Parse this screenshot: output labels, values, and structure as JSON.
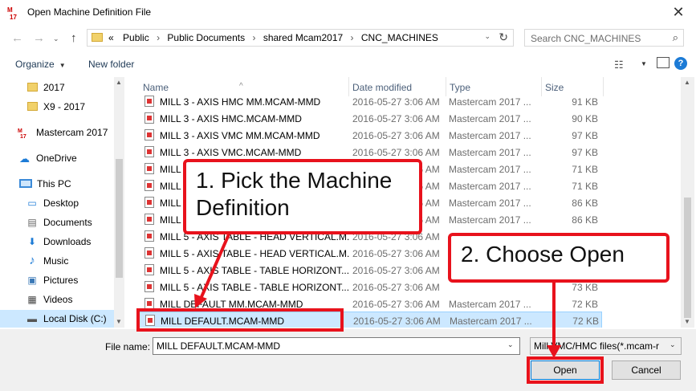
{
  "window": {
    "title": "Open Machine Definition File",
    "close": "✕",
    "logo": "mastercam-logo"
  },
  "nav": {
    "back": "←",
    "forward": "→",
    "up": "↑",
    "refresh": "↻",
    "dropdown": "⌄"
  },
  "address": {
    "overflow": "«",
    "crumbs": [
      "Public",
      "Public Documents",
      "shared Mcam2017",
      "CNC_MACHINES"
    ],
    "sep": "›"
  },
  "search": {
    "placeholder": "Search CNC_MACHINES",
    "icon": "⌕"
  },
  "toolbar": {
    "organize": "Organize",
    "new_folder": "New folder",
    "caret": "▼",
    "view_icon": "☷",
    "help": "?"
  },
  "sidebar": {
    "items": [
      {
        "label": "2017",
        "icon": "folder"
      },
      {
        "label": "X9 - 2017",
        "icon": "folder"
      },
      {
        "label": "Mastercam 2017",
        "icon": "mastercam"
      },
      {
        "label": "OneDrive",
        "icon": "cloud",
        "glyph": "☁"
      },
      {
        "label": "This PC",
        "icon": "pc"
      },
      {
        "label": "Desktop",
        "icon": "desktop",
        "glyph": "▭"
      },
      {
        "label": "Documents",
        "icon": "documents",
        "glyph": "▤"
      },
      {
        "label": "Downloads",
        "icon": "downloads",
        "glyph": "⬇"
      },
      {
        "label": "Music",
        "icon": "music",
        "glyph": "♪"
      },
      {
        "label": "Pictures",
        "icon": "pictures",
        "glyph": "▣"
      },
      {
        "label": "Videos",
        "icon": "videos",
        "glyph": "▦"
      },
      {
        "label": "Local Disk (C:)",
        "icon": "disk",
        "glyph": "▬"
      }
    ]
  },
  "columns": {
    "name": "Name",
    "date": "Date modified",
    "type": "Type",
    "size": "Size",
    "sort_caret": "^"
  },
  "files": [
    {
      "name": "MILL 3 - AXIS HMC MM.MCAM-MMD",
      "date": "2016-05-27 3:06 AM",
      "type": "Mastercam 2017 ...",
      "size": "91 KB"
    },
    {
      "name": "MILL 3 - AXIS HMC.MCAM-MMD",
      "date": "2016-05-27 3:06 AM",
      "type": "Mastercam 2017 ...",
      "size": "90 KB"
    },
    {
      "name": "MILL 3 - AXIS VMC MM.MCAM-MMD",
      "date": "2016-05-27 3:06 AM",
      "type": "Mastercam 2017 ...",
      "size": "97 KB"
    },
    {
      "name": "MILL 3 - AXIS VMC.MCAM-MMD",
      "date": "2016-05-27 3:06 AM",
      "type": "Mastercam 2017 ...",
      "size": "97 KB"
    },
    {
      "name": "MILL 4",
      "date": "2016-05-27 3:06 AM",
      "type": "Mastercam 2017 ...",
      "size": "71 KB"
    },
    {
      "name": "MILL 4",
      "date": "2016-05-27 3:06 AM",
      "type": "Mastercam 2017 ...",
      "size": "71 KB"
    },
    {
      "name": "MILL 5",
      "date": "2016-05-27 3:06 AM",
      "type": "Mastercam 2017 ...",
      "size": "86 KB"
    },
    {
      "name": "MILL 5",
      "date": "2016-05-27 3:06 AM",
      "type": "Mastercam 2017 ...",
      "size": "86 KB"
    },
    {
      "name": "MILL 5 - AXIS TABLE - HEAD VERTICAL.M...",
      "date": "2016-05-27 3:06 AM",
      "type": "",
      "size": ""
    },
    {
      "name": "MILL 5 - AXIS TABLE - HEAD VERTICAL.M...",
      "date": "2016-05-27 3:06 AM",
      "type": "",
      "size": ""
    },
    {
      "name": "MILL 5 - AXIS TABLE - TABLE HORIZONT...",
      "date": "2016-05-27 3:06 AM",
      "type": "",
      "size": ""
    },
    {
      "name": "MILL 5 - AXIS TABLE - TABLE HORIZONT...",
      "date": "2016-05-27 3:06 AM",
      "type": "",
      "size": "73 KB"
    },
    {
      "name": "MILL DEFAULT MM.MCAM-MMD",
      "date": "2016-05-27 3:06 AM",
      "type": "Mastercam 2017 ...",
      "size": "72 KB"
    },
    {
      "name": "MILL DEFAULT.MCAM-MMD",
      "date": "2016-05-27 3:06 AM",
      "type": "Mastercam 2017 ...",
      "size": "72 KB",
      "selected": true
    }
  ],
  "bottom": {
    "filename_label": "File name:",
    "filename_value": "MILL DEFAULT.MCAM-MMD",
    "filetype_value": "Mill VMC/HMC files(*.mcam-r",
    "dropdown": "⌄",
    "open": "Open",
    "cancel": "Cancel"
  },
  "annotations": {
    "step1": "1. Pick the Machine Definition",
    "step2": "2. Choose Open",
    "color": "#e8121c"
  }
}
